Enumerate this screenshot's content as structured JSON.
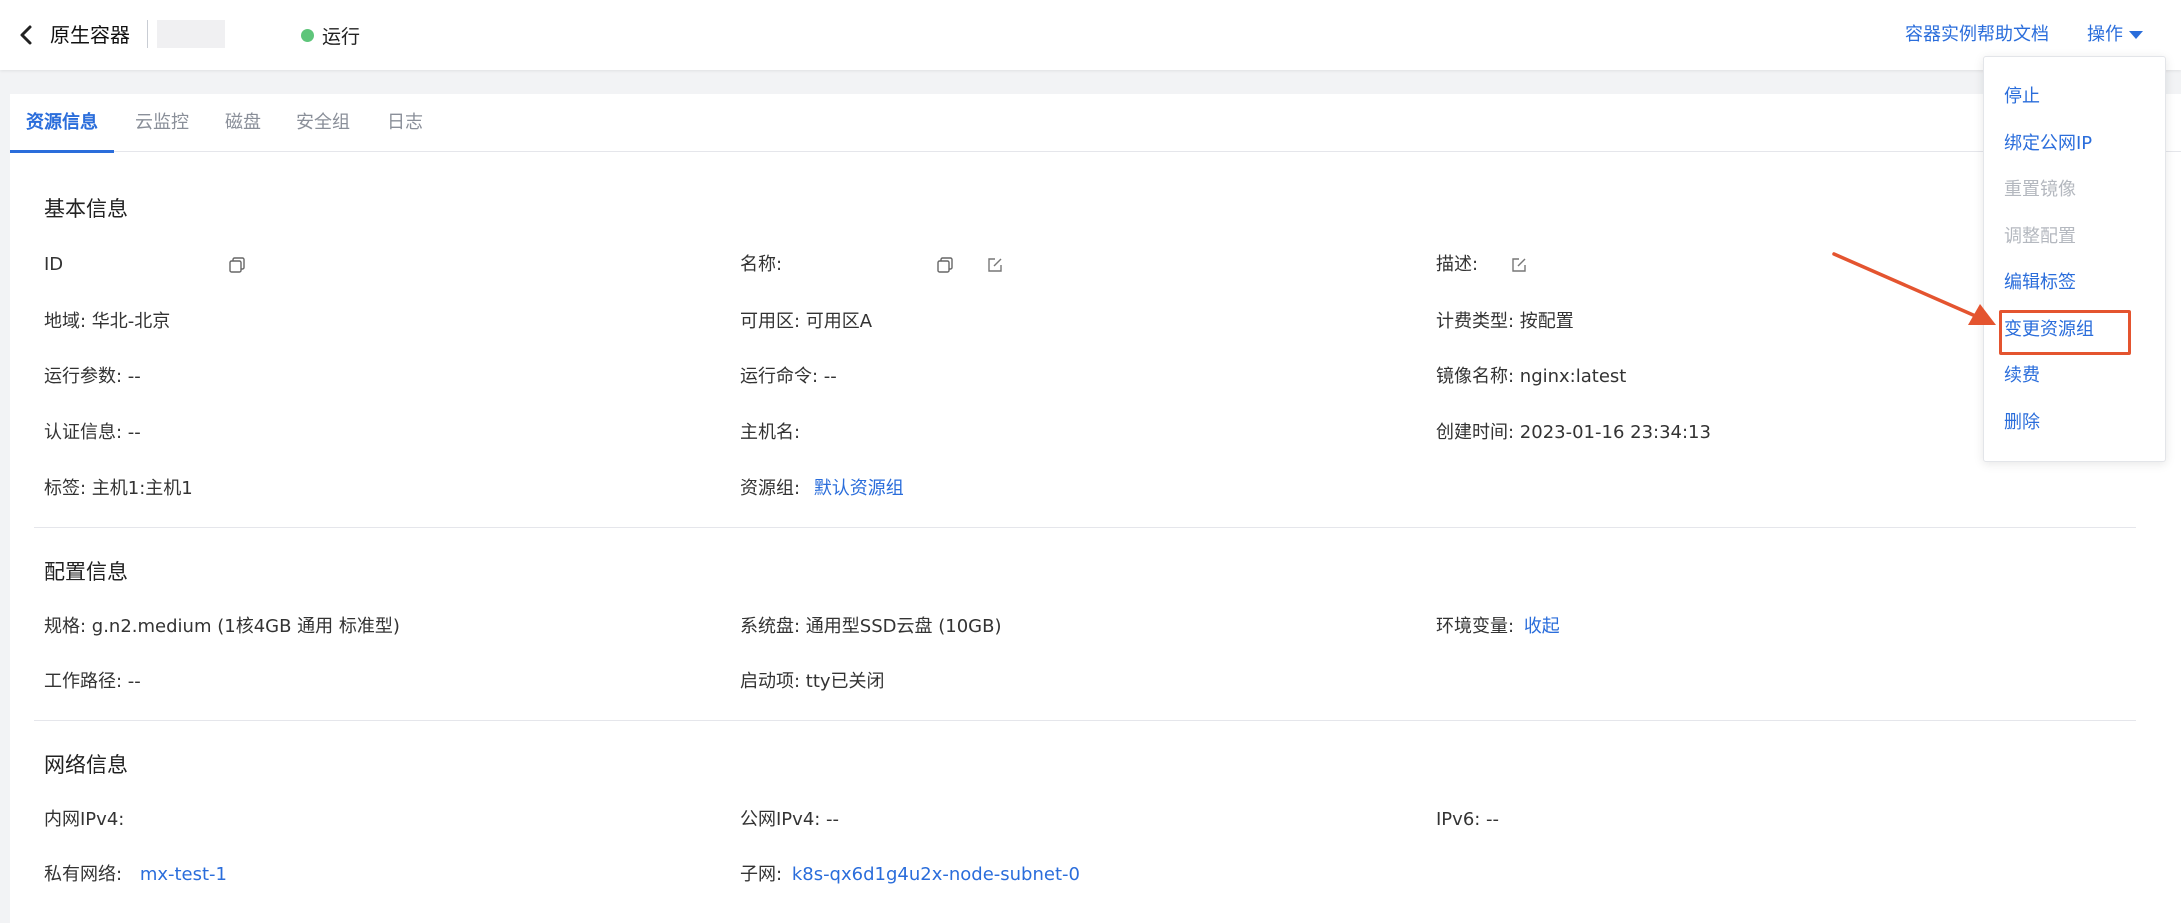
{
  "header": {
    "title": "原生容器",
    "status": "运行",
    "status_color": "#5ec57a",
    "help_link": "容器实例帮助文档",
    "operations_label": "操作"
  },
  "tabs": [
    {
      "label": "资源信息",
      "active": true
    },
    {
      "label": "云监控",
      "active": false
    },
    {
      "label": "磁盘",
      "active": false
    },
    {
      "label": "安全组",
      "active": false
    },
    {
      "label": "日志",
      "active": false
    }
  ],
  "basic": {
    "title": "基本信息",
    "id_label": "ID",
    "name_label": "名称:",
    "desc_label": "描述:",
    "region": "地域: 华北-北京",
    "zone": "可用区: 可用区A",
    "billing": "计费类型: 按配置",
    "run_params": "运行参数: --",
    "run_cmd": "运行命令: --",
    "image_name": "镜像名称: nginx:latest",
    "auth": "认证信息: --",
    "hostname_label": "主机名:",
    "created": "创建时间: 2023-01-16 23:34:13",
    "tags": "标签: 主机1:主机1",
    "resource_group_label": "资源组:",
    "resource_group_value": "默认资源组"
  },
  "config": {
    "title": "配置信息",
    "spec": "规格: g.n2.medium (1核4GB 通用 标准型)",
    "system_disk": "系统盘: 通用型SSD云盘 (10GB)",
    "env_label": "环境变量:",
    "env_value": "收起",
    "work_dir": "工作路径: --",
    "startup": "启动项: tty已关闭"
  },
  "network": {
    "title": "网络信息",
    "private_ipv4_label": "内网IPv4:",
    "public_ipv4": "公网IPv4: --",
    "ipv6": "IPv6: --",
    "vpc_label": "私有网络:",
    "vpc_value": "mx-test-1",
    "subnet_label": "子网:",
    "subnet_value": "k8s-qx6d1g4u2x-node-subnet-0"
  },
  "ops_menu": [
    {
      "label": "停止",
      "enabled": true
    },
    {
      "label": "绑定公网IP",
      "enabled": true
    },
    {
      "label": "重置镜像",
      "enabled": false
    },
    {
      "label": "调整配置",
      "enabled": false
    },
    {
      "label": "编辑标签",
      "enabled": true
    },
    {
      "label": "变更资源组",
      "enabled": true
    },
    {
      "label": "续费",
      "enabled": true
    },
    {
      "label": "删除",
      "enabled": true
    }
  ],
  "colors": {
    "accent": "#2a6ddb",
    "annotation": "#e4542f"
  }
}
